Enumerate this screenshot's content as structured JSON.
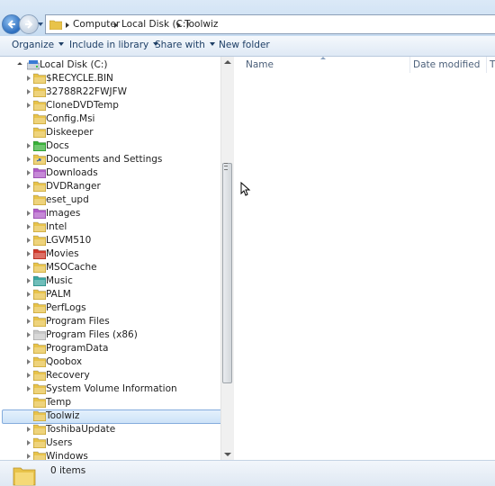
{
  "address": {
    "crumbs": [
      "Computer",
      "Local Disk (C:)",
      "Toolwiz"
    ]
  },
  "toolbar": {
    "organize": "Organize",
    "include_in_library": "Include in library",
    "share_with": "Share with",
    "new_folder": "New folder"
  },
  "tree": {
    "root_label": "Local Disk (C:)",
    "items": [
      {
        "label": "$RECYCLE.BIN",
        "expandable": true,
        "icon": "folder-icon",
        "color": "#e8c34a"
      },
      {
        "label": "32788R22FWJFW",
        "expandable": true,
        "icon": "folder-icon",
        "color": "#e8c34a"
      },
      {
        "label": "CloneDVDTemp",
        "expandable": true,
        "icon": "folder-icon",
        "color": "#e8c34a"
      },
      {
        "label": "Config.Msi",
        "expandable": false,
        "icon": "folder-icon",
        "color": "#e8c34a"
      },
      {
        "label": "Diskeeper",
        "expandable": false,
        "icon": "folder-icon",
        "color": "#e8c34a"
      },
      {
        "label": "Docs",
        "expandable": true,
        "icon": "green-folder-icon",
        "color": "#38b038"
      },
      {
        "label": "Documents and Settings",
        "expandable": true,
        "icon": "shortcut-folder-icon",
        "color": "#e8c34a"
      },
      {
        "label": "Downloads",
        "expandable": true,
        "icon": "purple-folder-icon",
        "color": "#b05cc8"
      },
      {
        "label": "DVDRanger",
        "expandable": true,
        "icon": "folder-icon",
        "color": "#e8c34a"
      },
      {
        "label": "eset_upd",
        "expandable": false,
        "icon": "folder-icon",
        "color": "#e8c34a"
      },
      {
        "label": "Images",
        "expandable": true,
        "icon": "purple-folder-icon",
        "color": "#b05cc8"
      },
      {
        "label": "Intel",
        "expandable": true,
        "icon": "folder-icon",
        "color": "#e8c34a"
      },
      {
        "label": "LGVM510",
        "expandable": true,
        "icon": "folder-icon",
        "color": "#e8c34a"
      },
      {
        "label": "Movies",
        "expandable": true,
        "icon": "red-folder-icon",
        "color": "#d0392b"
      },
      {
        "label": "MSOCache",
        "expandable": true,
        "icon": "folder-icon",
        "color": "#e8c34a"
      },
      {
        "label": "Music",
        "expandable": true,
        "icon": "teal-folder-icon",
        "color": "#3aa6a0"
      },
      {
        "label": "PALM",
        "expandable": true,
        "icon": "folder-icon",
        "color": "#e8c34a"
      },
      {
        "label": "PerfLogs",
        "expandable": true,
        "icon": "folder-icon",
        "color": "#e8c34a"
      },
      {
        "label": "Program Files",
        "expandable": true,
        "icon": "folder-icon",
        "color": "#e8c34a"
      },
      {
        "label": "Program Files (x86)",
        "expandable": true,
        "icon": "grey-folder-icon",
        "color": "#c9c9c9"
      },
      {
        "label": "ProgramData",
        "expandable": true,
        "icon": "folder-icon",
        "color": "#e8c34a"
      },
      {
        "label": "Qoobox",
        "expandable": true,
        "icon": "folder-icon",
        "color": "#e8c34a"
      },
      {
        "label": "Recovery",
        "expandable": true,
        "icon": "folder-icon",
        "color": "#e8c34a"
      },
      {
        "label": "System Volume Information",
        "expandable": true,
        "icon": "folder-icon",
        "color": "#e8c34a"
      },
      {
        "label": "Temp",
        "expandable": false,
        "icon": "folder-icon",
        "color": "#e8c34a"
      },
      {
        "label": "Toolwiz",
        "expandable": false,
        "icon": "folder-icon",
        "color": "#e8c34a",
        "selected": true
      },
      {
        "label": "ToshibaUpdate",
        "expandable": true,
        "icon": "folder-icon",
        "color": "#e8c34a"
      },
      {
        "label": "Users",
        "expandable": true,
        "icon": "folder-icon",
        "color": "#e8c34a"
      },
      {
        "label": "Windows",
        "expandable": true,
        "icon": "folder-icon",
        "color": "#e8c34a"
      }
    ]
  },
  "columns": {
    "name": "Name",
    "date_modified": "Date modified",
    "type_truncated": "T"
  },
  "status": {
    "item_count": "0 items"
  }
}
